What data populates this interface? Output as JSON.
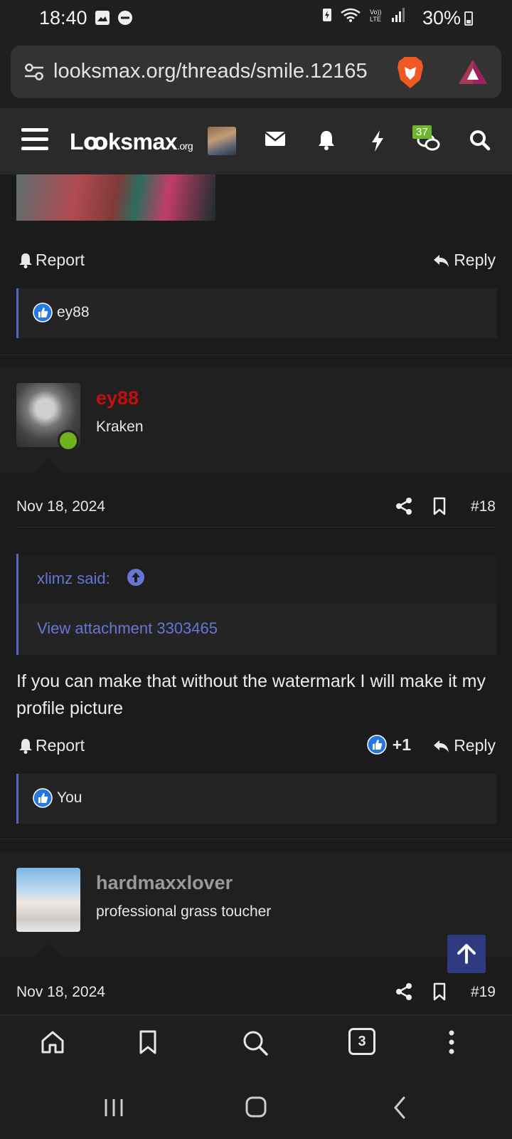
{
  "status_bar": {
    "time": "18:40",
    "battery": "30%"
  },
  "browser": {
    "url": "looksmax.org/threads/smile.12165"
  },
  "site_header": {
    "logo_main": "Lꝏksmax",
    "logo_suffix": ".org",
    "alerts_badge": "37"
  },
  "post17": {
    "report_label": "Report",
    "reply_label": "Reply",
    "reactions_text": "ey88"
  },
  "post18": {
    "username": "ey88",
    "username_color": "#c40f0f",
    "user_title": "Kraken",
    "date": "Nov 18, 2024",
    "post_number": "#18",
    "quote_author": "xlimz said:",
    "quote_content": "View attachment 3303465",
    "body": "If you can make that without the watermark I will make it my profile picture",
    "report_label": "Report",
    "like_count": "+1",
    "reply_label": "Reply",
    "reactions_text": "You"
  },
  "post19": {
    "username": "hardmaxxlover",
    "username_color": "#9a9a9a",
    "user_title": "professional grass toucher",
    "date": "Nov 18, 2024",
    "post_number": "#19"
  },
  "bottom_nav": {
    "tab_count": "3"
  },
  "colors": {
    "accent": "#5865c8",
    "link": "#6776d4",
    "online": "#6fb21e",
    "badge": "#6fb52e"
  }
}
